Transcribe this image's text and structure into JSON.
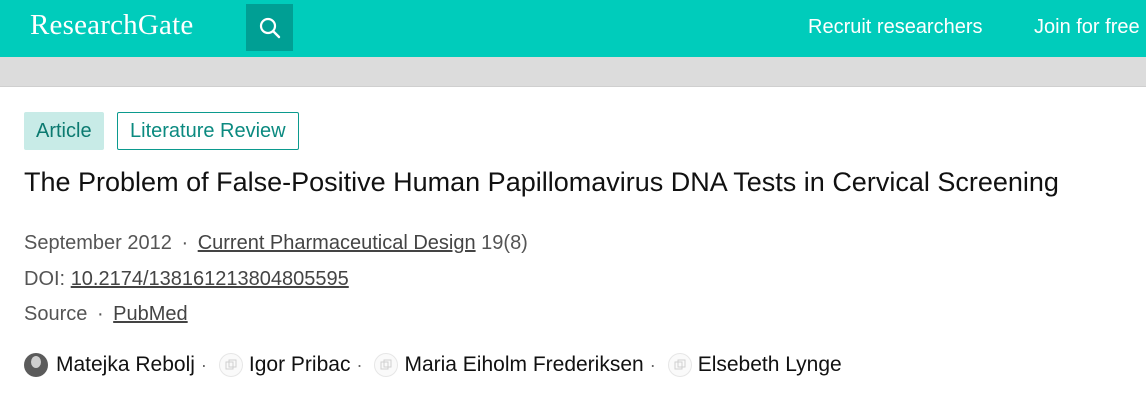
{
  "header": {
    "logo": "ResearchGate",
    "search_icon": "search-icon",
    "nav": {
      "recruit": "Recruit researchers",
      "join": "Join for free"
    },
    "colors": {
      "brand": "#00ccbb",
      "search_bg": "#009f94"
    }
  },
  "badges": {
    "article": "Article",
    "review": "Literature Review"
  },
  "article": {
    "title": "The Problem of False-Positive Human Papillomavirus DNA Tests in Cervical Screening",
    "date": "September 2012",
    "journal": "Current Pharmaceutical Design",
    "volume": "19(8)",
    "doi_label": "DOI:",
    "doi": "10.2174/138161213804805595",
    "source_label": "Source",
    "source": "PubMed",
    "separator": "·"
  },
  "authors": [
    {
      "name": "Matejka Rebolj",
      "avatar": "photo"
    },
    {
      "name": "Igor Pribac",
      "avatar": "placeholder"
    },
    {
      "name": "Maria Eiholm Frederiksen",
      "avatar": "placeholder"
    },
    {
      "name": "Elsebeth Lynge",
      "avatar": "placeholder"
    }
  ]
}
